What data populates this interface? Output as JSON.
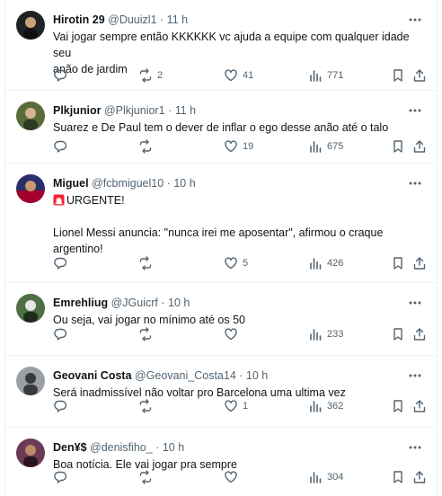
{
  "tweets": [
    {
      "name": "Hirotin 29",
      "handle": "@Duuizl1",
      "time": "11 h",
      "lines": [
        "Vai jogar sempre então KKKKKK vc ajuda a equipe com qualquer idade seu",
        "anão de jardim"
      ],
      "replies": "",
      "retweets": "2",
      "likes": "41",
      "views": "771",
      "avatar_color": "#1f2326"
    },
    {
      "name": "Plkjunior",
      "handle": "@Plkjunior1",
      "time": "11 h",
      "lines": [
        "Suarez e De Paul tem o dever de inflar o ego desse anão até o talo"
      ],
      "replies": "",
      "retweets": "",
      "likes": "19",
      "views": "675",
      "avatar_color": "#5a6b3a"
    },
    {
      "name": "Miguel",
      "handle": "@fcbmiguel10",
      "time": "10 h",
      "lines": [
        "URGENTE!",
        "",
        "Lionel Messi anuncia: \"nunca irei me aposentar\", afirmou o craque",
        "argentino!"
      ],
      "replies": "",
      "retweets": "",
      "likes": "5",
      "views": "426",
      "avatar_color": "#2a2f6b"
    },
    {
      "name": "Emrehliug",
      "handle": "@JGuicrf",
      "time": "10 h",
      "lines": [
        "Ou seja, vai jogar no mínimo até os 50"
      ],
      "replies": "",
      "retweets": "",
      "likes": "",
      "views": "233",
      "avatar_color": "#4f6f47"
    },
    {
      "name": "Geovani Costa",
      "handle": "@Geovani_Costa14",
      "time": "10 h",
      "lines": [
        "Será inadmissível não voltar pro Barcelona uma ultima vez"
      ],
      "replies": "",
      "retweets": "",
      "likes": "1",
      "views": "362",
      "avatar_color": "#3a3a3a"
    },
    {
      "name": "Den¥$",
      "handle": "@denisfiho_",
      "time": "10 h",
      "lines": [
        "Boa notícia. Ele vai jogar pra sempre"
      ],
      "replies": "",
      "retweets": "",
      "likes": "",
      "views": "304",
      "avatar_color": "#6b3b55"
    }
  ],
  "separator": "·",
  "colors": {
    "text": "#0f1419",
    "secondary": "#536471",
    "border": "#eff3f4",
    "alert": "#f4212e"
  }
}
